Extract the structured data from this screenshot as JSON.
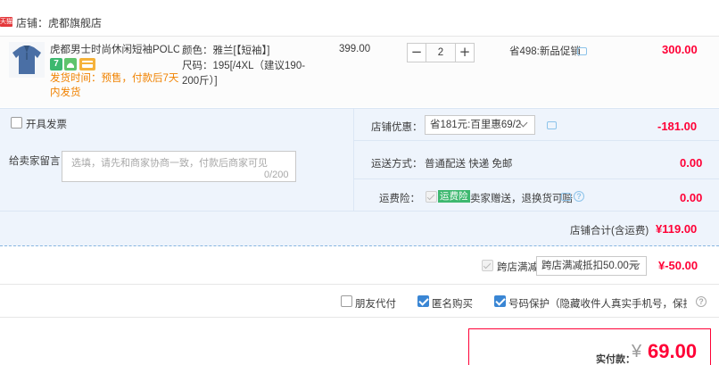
{
  "store": {
    "badge": "天猫",
    "name": "店铺：虎都旗舰店"
  },
  "item": {
    "title": "虎都男士时尚休闲短袖POLO衫…",
    "icon_7": "7",
    "ship_note": "发货时间：预售，付款后7天内发货",
    "sku_color": "颜色：雅兰[【短袖】]",
    "sku_size": "尺码：195[/4XL（建议190-200斤）]",
    "unit_price": "399.00",
    "quantity": "2",
    "qty_minus": "−",
    "qty_plus": "+",
    "promo": "省498:新品促销",
    "total": "300.00"
  },
  "options": {
    "invoice_label": "开具发票",
    "memo_label": "给卖家留言：",
    "memo_placeholder": "选填，请先和商家协商一致，付款后商家可见",
    "memo_count": "0/200",
    "coupon_label": "店铺优惠：",
    "coupon_selected": "省181元:百里惠69/2",
    "coupon_amount": "-181.00",
    "shipping_label": "运送方式：",
    "shipping_value": "普通配送 快递 免邮",
    "shipping_amount": "0.00",
    "insurance_label": "运费险：",
    "insurance_tag": "运费险",
    "insurance_text": "卖家赠送，退换货可赔",
    "insurance_amount": "0.00",
    "store_total_label": "店铺合计(含运费)",
    "store_total": "¥119.00"
  },
  "cross_store": {
    "label": "跨店满减",
    "selected": "跨店满减抵扣50.00元",
    "amount": "¥-50.00"
  },
  "checkout_opts": {
    "proxy_pay": "朋友代付",
    "anonymous": "匿名购买",
    "privacy": "号码保护（隐藏收件人真实手机号，保护隐私）",
    "help": "?"
  },
  "payment": {
    "label": "实付款：",
    "currency": "¥",
    "amount": "69.00"
  },
  "colors": {
    "accent_red": "#ff0036",
    "shade_blue": "#eef4fc",
    "check_blue": "#3a86d4",
    "warn_orange": "#f08200"
  }
}
